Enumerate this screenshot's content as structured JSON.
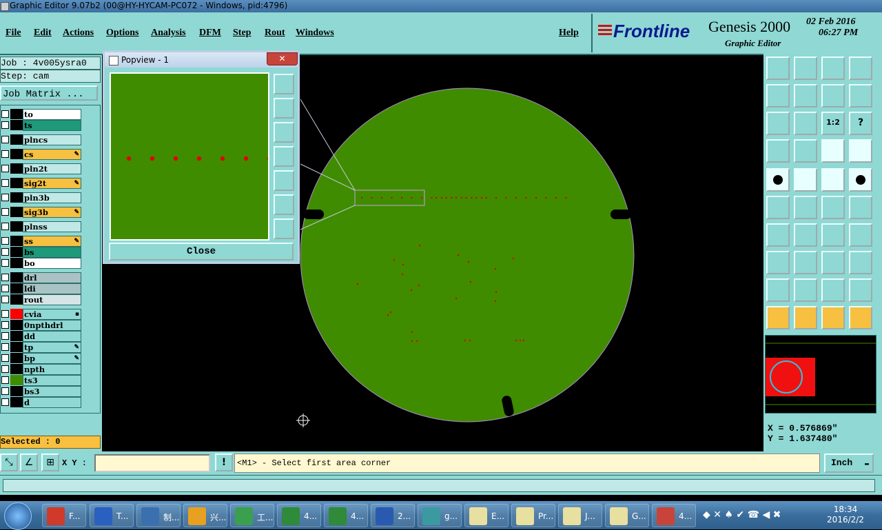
{
  "window": {
    "title": "Graphic Editor 9.07b2 (00@HY-HYCAM-PC072 - Windows, pid:4796)"
  },
  "menu": {
    "items": [
      "File",
      "Edit",
      "Actions",
      "Options",
      "Analysis",
      "DFM",
      "Step",
      "Rout",
      "Windows"
    ],
    "help": "Help"
  },
  "brand": {
    "logo": "Frontline",
    "product": "Genesis 2000",
    "subtitle": "Graphic Editor",
    "date": "02 Feb 2016",
    "time": "06:27 PM"
  },
  "job": {
    "job_line": "Job : 4v005ysra0",
    "step_line": "Step: cam",
    "matrix_button": "Job Matrix ..."
  },
  "layers": [
    {
      "name": "to",
      "bg": "#ffffff",
      "color": "#000000",
      "mark": ""
    },
    {
      "name": "ts",
      "bg": "#1e9a7a",
      "color": "#000000",
      "mark": ""
    },
    {
      "name": "plncs",
      "bg": "#bfe8e6",
      "color": "#000000",
      "mark": ""
    },
    {
      "name": "cs",
      "bg": "#f7c040",
      "color": "#000000",
      "mark": "✎"
    },
    {
      "name": "pln2t",
      "bg": "#bfe8e6",
      "color": "#000000",
      "mark": ""
    },
    {
      "name": "sig2t",
      "bg": "#f7c040",
      "color": "#000000",
      "mark": "✎"
    },
    {
      "name": "pln3b",
      "bg": "#bfe8e6",
      "color": "#000000",
      "mark": ""
    },
    {
      "name": "sig3b",
      "bg": "#f7c040",
      "color": "#000000",
      "mark": "✎"
    },
    {
      "name": "plnss",
      "bg": "#bfe8e6",
      "color": "#000000",
      "mark": ""
    },
    {
      "name": "ss",
      "bg": "#f7c040",
      "color": "#000000",
      "mark": "✎"
    },
    {
      "name": "bs",
      "bg": "#1e9a7a",
      "color": "#000000",
      "mark": ""
    },
    {
      "name": "bo",
      "bg": "#ffffff",
      "color": "#000000",
      "mark": ""
    },
    {
      "name": "drl",
      "bg": "#a9c3c5",
      "color": "#000000",
      "mark": ""
    },
    {
      "name": "ldi",
      "bg": "#a9c3c5",
      "color": "#000000",
      "mark": ""
    },
    {
      "name": "rout",
      "bg": "#d6e4e6",
      "color": "#000000",
      "mark": ""
    },
    {
      "name": "cvia",
      "bg": "#8fd8d4",
      "color": "#ff0000",
      "mark": "▪"
    },
    {
      "name": "0npthdrl",
      "bg": "#8fd8d4",
      "color": "#000000",
      "mark": ""
    },
    {
      "name": "dd",
      "bg": "#8fd8d4",
      "color": "#000000",
      "mark": ""
    },
    {
      "name": "tp",
      "bg": "#8fd8d4",
      "color": "#000000",
      "mark": "✎"
    },
    {
      "name": "bp",
      "bg": "#8fd8d4",
      "color": "#000000",
      "mark": "✎"
    },
    {
      "name": "npth",
      "bg": "#8fd8d4",
      "color": "#000000",
      "mark": ""
    },
    {
      "name": "ts3",
      "bg": "#8fd8d4",
      "color": "#3f8c00",
      "mark": ""
    },
    {
      "name": "bs3",
      "bg": "#8fd8d4",
      "color": "#000000",
      "mark": ""
    },
    {
      "name": "d",
      "bg": "#8fd8d4",
      "color": "#000000",
      "mark": ""
    }
  ],
  "selected_text": "Selected : 0",
  "popview": {
    "title": "Popview - 1",
    "close_x": "✕",
    "close_label": "Close"
  },
  "bottom": {
    "xy_label": "X Y :",
    "xy_value": "",
    "prompt": "<M1> - Select first area corner",
    "unit": "Inch",
    "warn": "!"
  },
  "coords": {
    "x": "X = 0.576869\"",
    "y": "Y = 1.637480\""
  },
  "taskbar": {
    "items": [
      {
        "label": "F...",
        "icon_color": "#d03a2a"
      },
      {
        "label": "T...",
        "icon_color": "#2a60c0"
      },
      {
        "label": "制...",
        "icon_color": "#3a70b0"
      },
      {
        "label": "兴...",
        "icon_color": "#e8a020"
      },
      {
        "label": "工...",
        "icon_color": "#3aa050"
      },
      {
        "label": "4...",
        "icon_color": "#2f8a3a"
      },
      {
        "label": "4...",
        "icon_color": "#2f8a3a"
      },
      {
        "label": "2...",
        "icon_color": "#2a5ab0"
      },
      {
        "label": "g...",
        "icon_color": "#3a9aa0"
      },
      {
        "label": "E...",
        "icon_color": "#e8e0a0"
      },
      {
        "label": "Pr...",
        "icon_color": "#e8e0a0"
      },
      {
        "label": "J...",
        "icon_color": "#e8e0a0"
      },
      {
        "label": "G...",
        "icon_color": "#e8e0a0"
      },
      {
        "label": "4...",
        "icon_color": "#c8443a"
      }
    ],
    "time": "18:34",
    "date": "2016/2/2"
  },
  "colors": {
    "board": "#3f8c00",
    "pad": "#e00000",
    "background": "#000000",
    "panel": "#8fd8d4"
  }
}
